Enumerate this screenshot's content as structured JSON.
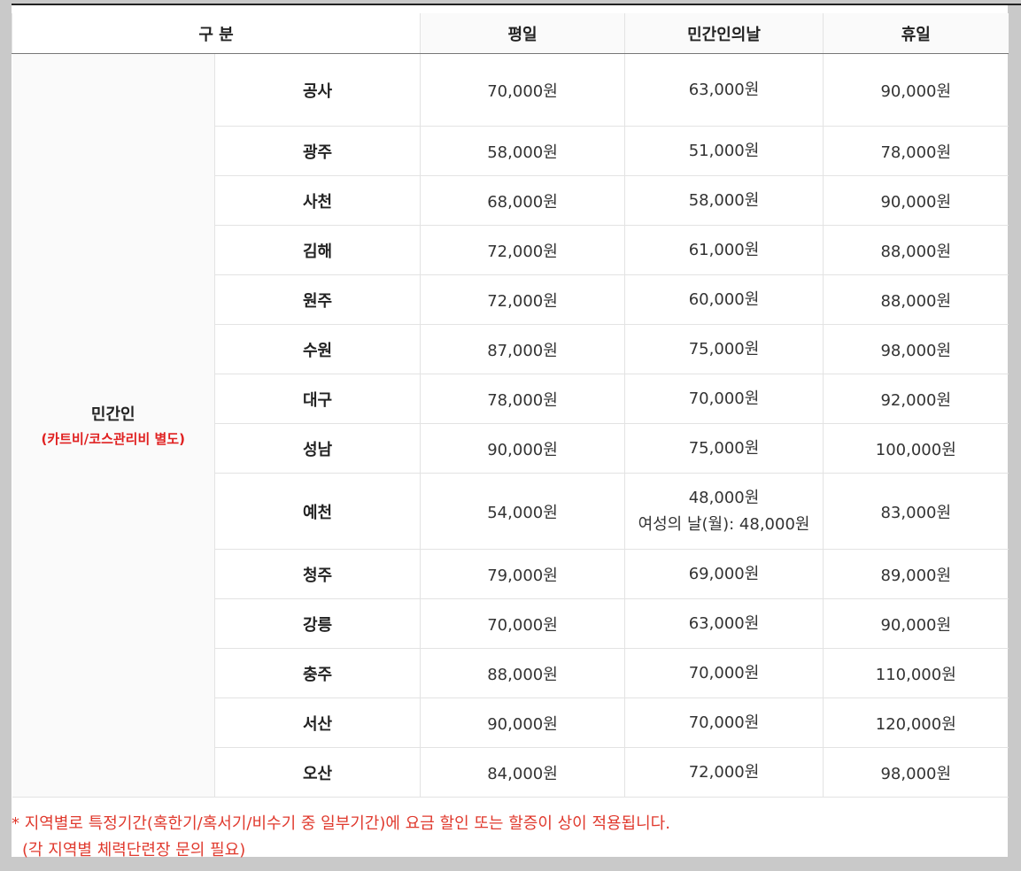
{
  "table": {
    "headers": {
      "category": "구 분",
      "weekday": "평일",
      "civilian_day": "민간인의날",
      "holiday": "휴일"
    },
    "group": {
      "title": "민간인",
      "subtitle": "(카트비/코스관리비 별도)"
    },
    "rows": [
      {
        "region": "공사",
        "weekday": "70,000원",
        "civilian_day": "63,000원",
        "holiday": "90,000원"
      },
      {
        "region": "광주",
        "weekday": "58,000원",
        "civilian_day": "51,000원",
        "holiday": "78,000원"
      },
      {
        "region": "사천",
        "weekday": "68,000원",
        "civilian_day": "58,000원",
        "holiday": "90,000원"
      },
      {
        "region": "김해",
        "weekday": "72,000원",
        "civilian_day": "61,000원",
        "holiday": "88,000원"
      },
      {
        "region": "원주",
        "weekday": "72,000원",
        "civilian_day": "60,000원",
        "holiday": "88,000원"
      },
      {
        "region": "수원",
        "weekday": "87,000원",
        "civilian_day": "75,000원",
        "holiday": "98,000원"
      },
      {
        "region": "대구",
        "weekday": "78,000원",
        "civilian_day": "70,000원",
        "holiday": "92,000원"
      },
      {
        "region": "성남",
        "weekday": "90,000원",
        "civilian_day": "75,000원",
        "holiday": "100,000원"
      },
      {
        "region": "예천",
        "weekday": "54,000원",
        "civilian_day": "48,000원",
        "civilian_day_extra": "여성의 날(월): 48,000원",
        "holiday": "83,000원"
      },
      {
        "region": "청주",
        "weekday": "79,000원",
        "civilian_day": "69,000원",
        "holiday": "89,000원"
      },
      {
        "region": "강릉",
        "weekday": "70,000원",
        "civilian_day": "63,000원",
        "holiday": "90,000원"
      },
      {
        "region": "충주",
        "weekday": "88,000원",
        "civilian_day": "70,000원",
        "holiday": "110,000원"
      },
      {
        "region": "서산",
        "weekday": "90,000원",
        "civilian_day": "70,000원",
        "holiday": "120,000원"
      },
      {
        "region": "오산",
        "weekday": "84,000원",
        "civilian_day": "72,000원",
        "holiday": "98,000원"
      }
    ]
  },
  "note": {
    "star": "*",
    "line1": "지역별로 특정기간(혹한기/혹서기/비수기 중 일부기간)에 요금 할인 또는 할증이 상이 적용됩니다.",
    "line2": "(각 지역별 체력단련장 문의 필요)"
  },
  "colors": {
    "note_red": "#e03a2e",
    "group_sub_red": "#e02020"
  }
}
